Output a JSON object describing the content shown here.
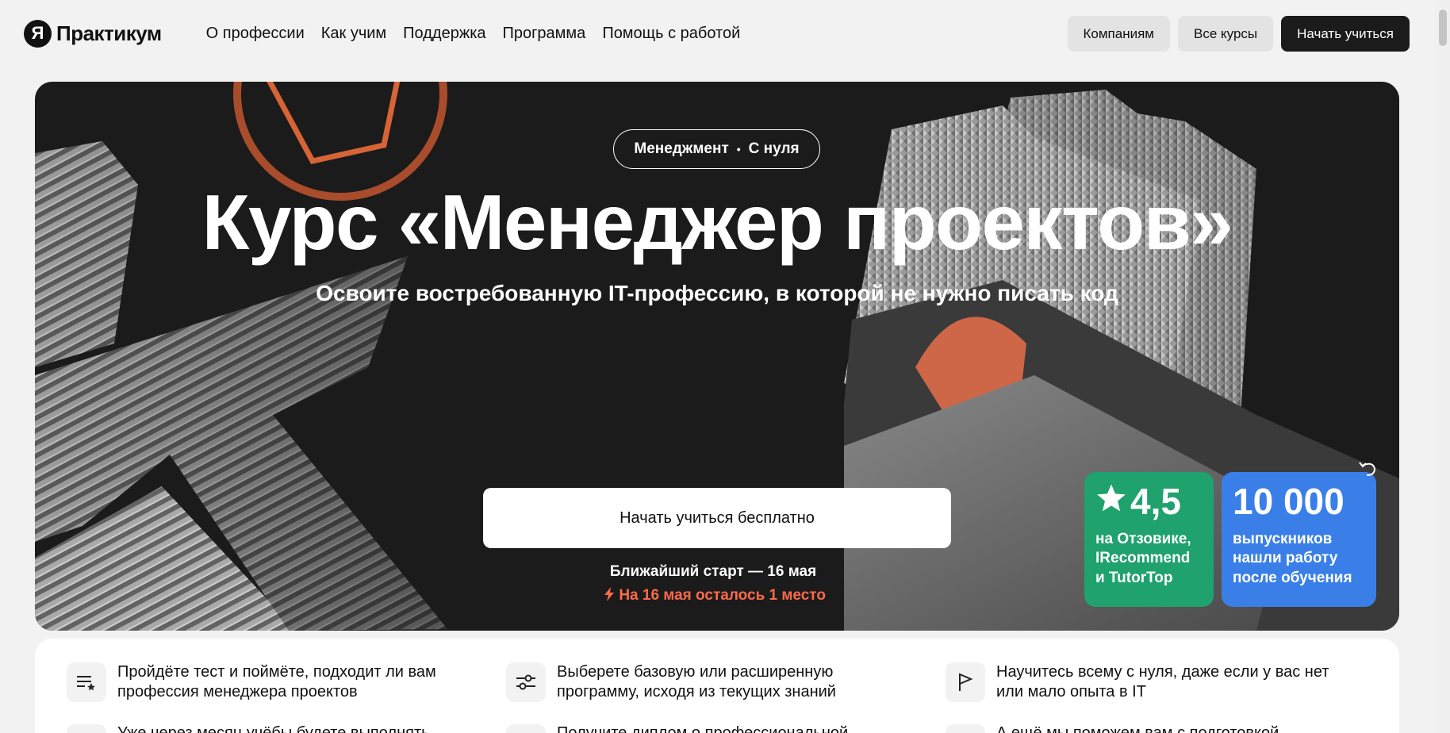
{
  "header": {
    "logo_letter": "Я",
    "logo_text": "Практикум",
    "nav": [
      {
        "label": "О профессии"
      },
      {
        "label": "Как учим"
      },
      {
        "label": "Поддержка"
      },
      {
        "label": "Программа"
      },
      {
        "label": "Помощь с работой"
      }
    ],
    "btn_companies": "Компаниям",
    "btn_all_courses": "Все курсы",
    "btn_start": "Начать учиться"
  },
  "hero": {
    "tag_left": "Менеджмент",
    "tag_dot": "•",
    "tag_right": "С нуля",
    "title": "Курс «Менеджер проектов»",
    "subtitle": "Освоите востребованную IT-профессию, в которой не нужно писать код",
    "cta": "Начать учиться бесплатно",
    "start": "Ближайший старт — 16 мая",
    "seats": "На 16 мая осталось 1 место",
    "rating_value": "4,5",
    "rating_text_1": "на Отзовике,",
    "rating_text_2": "IRecommend",
    "rating_text_3": "и TutorTop",
    "graduates_value": "10 000",
    "graduates_text_1": "выпускников",
    "graduates_text_2": "нашли работу",
    "graduates_text_3": "после обучения",
    "colors": {
      "green": "#1fa26d",
      "blue": "#3a7fe8",
      "accent": "#ff6a4a",
      "dark": "#1b1b1b"
    }
  },
  "features": [
    {
      "line1": "Пройдёте тест и поймёте, подходит ли вам",
      "line2": "профессия менеджера проектов",
      "icon": "list-star-icon"
    },
    {
      "line1": "Выберете базовую или расширенную",
      "line2": "программу, исходя из текущих знаний",
      "icon": "sliders-icon"
    },
    {
      "line1": "Научитесь всему с нуля, даже если у вас нет",
      "line2": "или мало опыта в IT",
      "icon": "flag-icon"
    }
  ],
  "features_row2": [
    {
      "text": "Уже через месяц учёбы будете выполнять"
    },
    {
      "text": "Получите диплом о профессиональной"
    },
    {
      "text": "А ещё мы поможем вам с подготовкой"
    }
  ]
}
